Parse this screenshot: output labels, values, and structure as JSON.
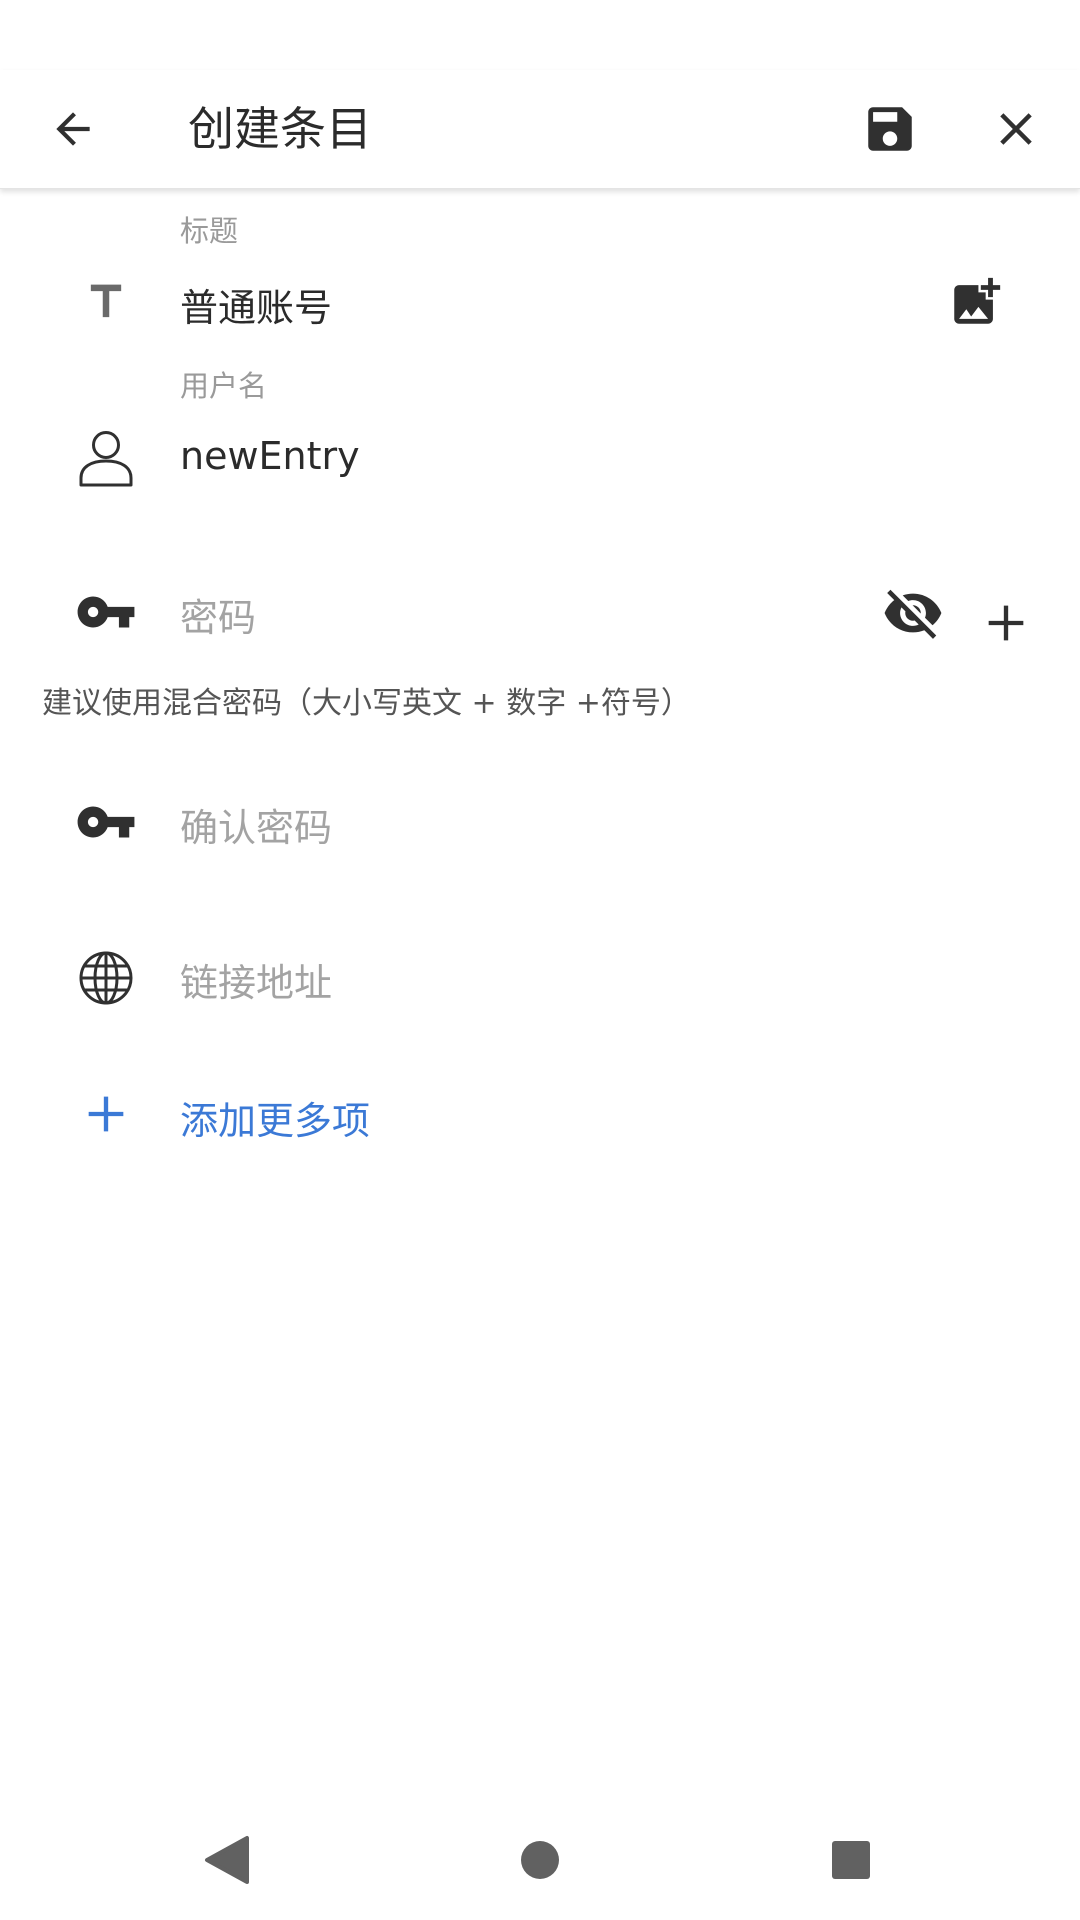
{
  "app_bar": {
    "title": "创建条目",
    "icons": {
      "back": "arrow-back-icon",
      "save": "save-icon",
      "close": "close-icon"
    }
  },
  "fields": {
    "title": {
      "label": "标题",
      "value": "普通账号",
      "icon": "text-icon",
      "action_icon": "add-image-icon"
    },
    "username": {
      "label": "用户名",
      "value": "newEntry",
      "icon": "person-icon"
    },
    "password": {
      "placeholder": "密码",
      "icon": "key-icon",
      "visibility_icon": "eye-off-icon",
      "add_icon": "plus-icon"
    },
    "password_hint": "建议使用混合密码（大小写英文 + 数字 +符号）",
    "confirm_password": {
      "placeholder": "确认密码",
      "icon": "key-icon"
    },
    "url": {
      "placeholder": "链接地址",
      "icon": "globe-icon"
    }
  },
  "add_more": {
    "label": "添加更多项",
    "icon": "plus-icon",
    "color": "#3b79d6"
  },
  "nav": {
    "back": "nav-back-icon",
    "home": "nav-home-icon",
    "recents": "nav-recents-icon"
  }
}
